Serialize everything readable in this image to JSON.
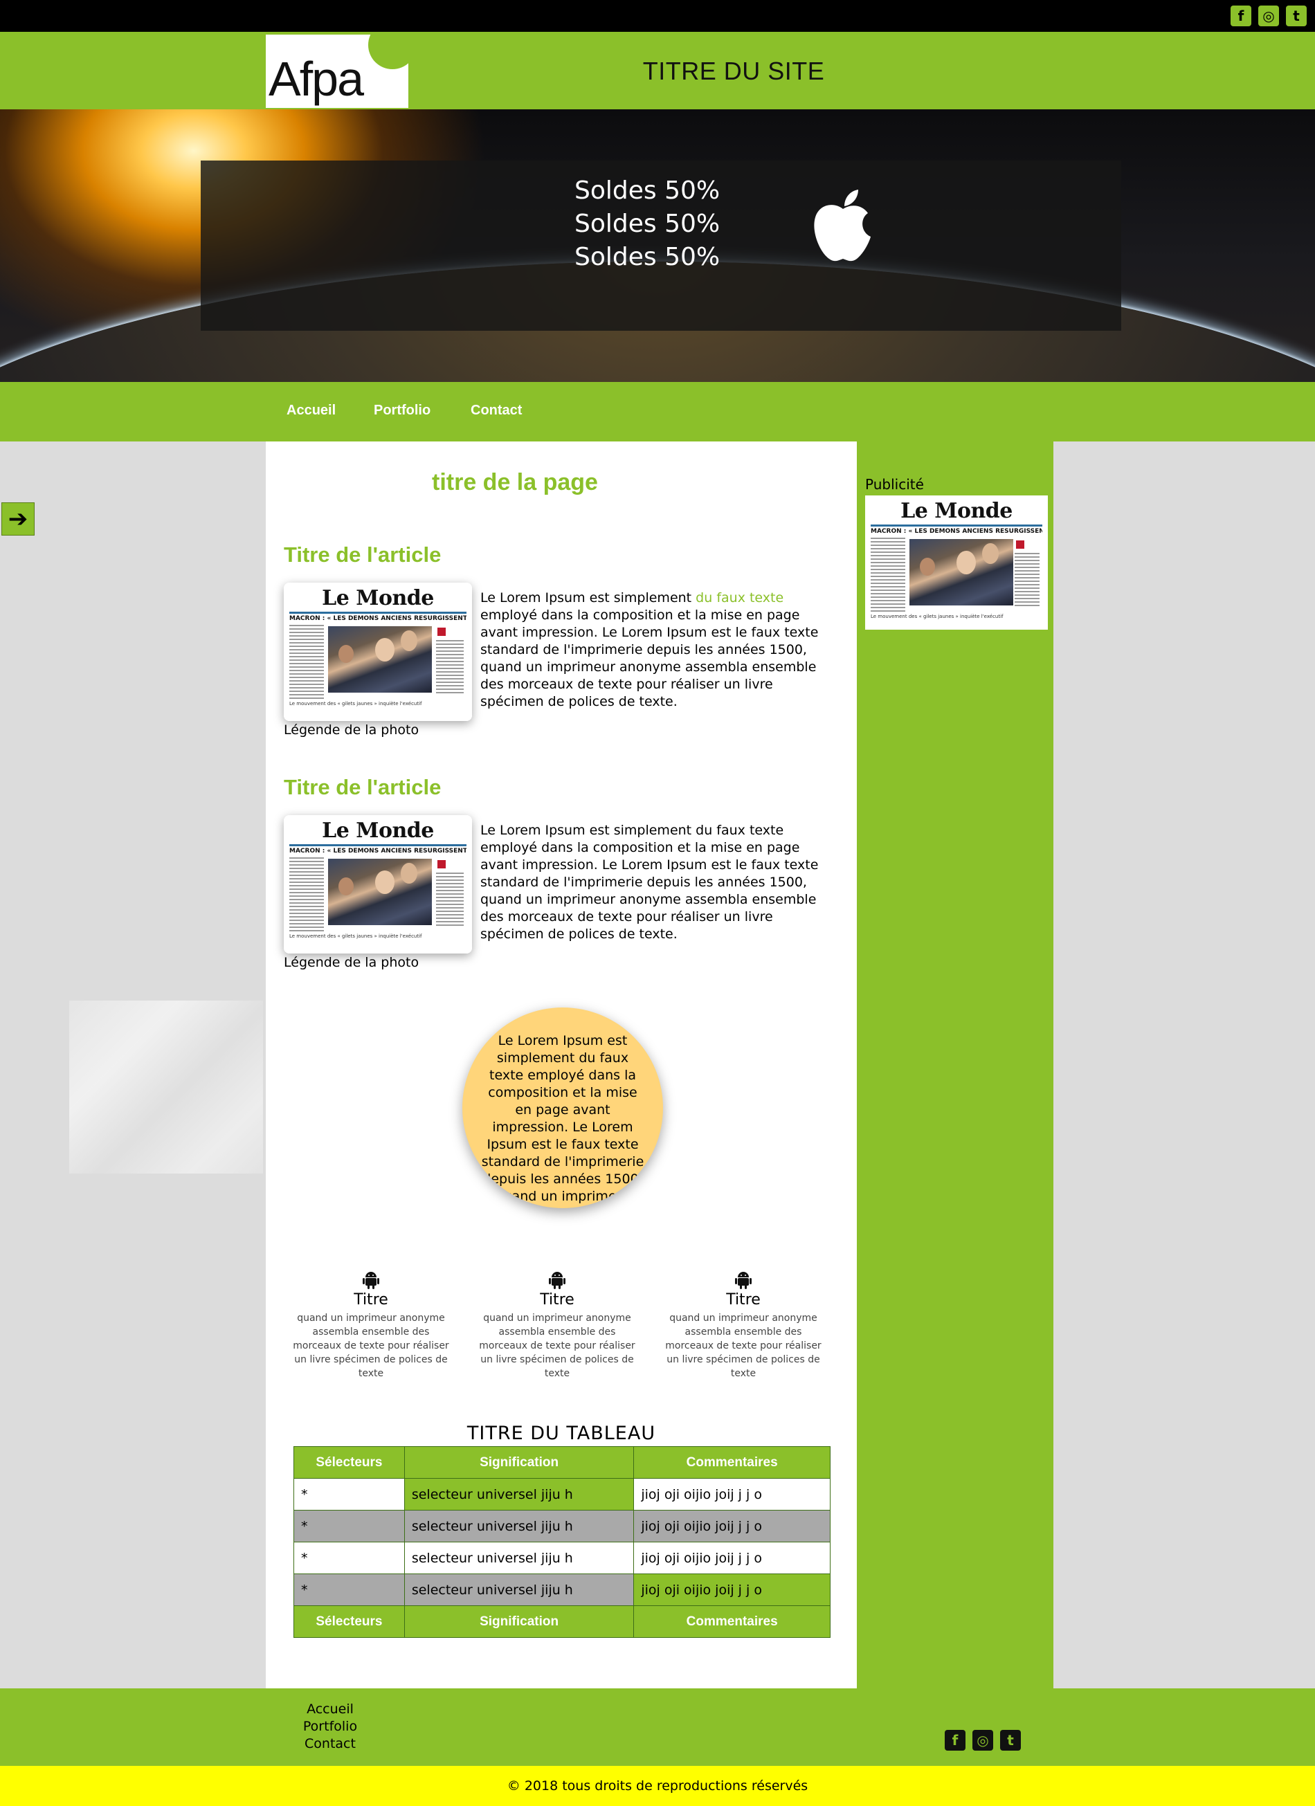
{
  "social": {
    "icons": [
      "facebook-icon",
      "instagram-icon",
      "twitter-icon"
    ],
    "glyphs": [
      "f",
      "◎",
      "t"
    ]
  },
  "header": {
    "logo_text": "Afpa",
    "site_title": "TITRE DU SITE"
  },
  "hero": {
    "promo_lines": [
      "Soldes 50%",
      "Soldes 50%",
      "Soldes 50%"
    ],
    "promo_icon": "apple-icon"
  },
  "nav": {
    "items": [
      "Accueil",
      "Portfolio",
      "Contact"
    ]
  },
  "main": {
    "page_title": "titre de la page",
    "articles": [
      {
        "title": "Titre de l'article",
        "text_before_link": "Le Lorem Ipsum est simplement ",
        "link": "du faux texte",
        "text_after_link": " employé dans la composition et la mise en page avant impression. Le Lorem Ipsum est le faux texte standard de l'imprimerie depuis les années 1500,",
        "text_2": "quand un imprimeur anonyme assembla ensemble des morceaux de texte pour réaliser un livre spécimen de polices de texte.",
        "caption": "Légende de la photo"
      },
      {
        "title": "Titre de l'article",
        "text_1": "Le Lorem Ipsum est simplement du faux texte employé dans la composition et la mise en page avant impression. Le Lorem Ipsum est le faux texte standard de l'imprimerie depuis les années 1500,",
        "text_2": "quand un imprimeur anonyme assembla ensemble des morceaux de texte pour réaliser un livre spécimen de polices de texte.",
        "caption": "Légende de la photo"
      }
    ],
    "circle_text": "Le Lorem Ipsum est simplement du faux texte employé dans la composition et la mise en page avant impression. Le Lorem Ipsum est le faux texte standard de l'imprimerie depuis les années 1500, quand un imprimeur anonyme assembla ensemble",
    "features": [
      {
        "icon": "android-icon",
        "title": "Titre",
        "text": "quand un imprimeur anonyme assembla ensemble des morceaux de texte pour réaliser un livre spécimen de polices de texte"
      },
      {
        "icon": "android-icon",
        "title": "Titre",
        "text": "quand un imprimeur anonyme assembla ensemble des morceaux de texte pour réaliser un livre spécimen de polices de texte"
      },
      {
        "icon": "android-icon",
        "title": "Titre",
        "text": "quand un imprimeur anonyme assembla ensemble des morceaux de texte pour réaliser un livre spécimen de polices de texte"
      }
    ],
    "table": {
      "title": "TITRE DU TABLEAU",
      "headers": [
        "Sélecteurs",
        "Signification",
        "Commentaires"
      ],
      "rows": [
        [
          "*",
          "selecteur universel jiju h",
          "jioj oji oijio joij j j o"
        ],
        [
          "*",
          "selecteur universel jiju h",
          "jioj oji oijio joij j j o"
        ],
        [
          "*",
          "selecteur universel jiju h",
          "jioj oji oijio joij j j o"
        ],
        [
          "*",
          "selecteur universel jiju h",
          "jioj oji oijio joij j j o"
        ]
      ],
      "footers": [
        "Sélecteurs",
        "Signification",
        "Commentaires"
      ]
    }
  },
  "aside": {
    "label": "Publicité"
  },
  "newspaper": {
    "masthead": "Le Monde",
    "headline": "MACRON : « LES DÉMONS ANCIENS RESURGISSENT »",
    "footer_line": "Le mouvement des « gilets jaunes » inquiète l'exécutif"
  },
  "footer": {
    "links": [
      "Accueil",
      "Portfolio",
      "Contact"
    ],
    "copyright": "© 2018 tous droits de reproductions réservés"
  },
  "colors": {
    "brand_green": "#8bc02a",
    "copyright_bar": "#ffff00",
    "circle": "#ffd57a",
    "row_grey": "#a9a9a9"
  }
}
